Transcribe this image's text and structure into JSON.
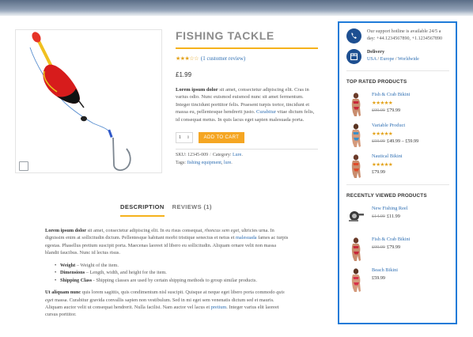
{
  "product": {
    "title": "FISHING TACKLE",
    "review_link": "(1 customer review)",
    "price": "£1.99",
    "desc_lead": "Lorem ipsum dolor",
    "desc_rest": " sit amet, consectetur adipiscing elit. Cras in varius odio. Nunc euismod euismod nunc sit amet fermentum. Integer tincidunt porttitor felis. Praesent turpis tortor, tincidunt et massa eu, pellentesque hendrerit justo. ",
    "desc_link": "Curabitur",
    "desc_tail": " vitae dictum felis, id consequat metus. In quis lacus eget sapien malesuada porta.",
    "quantity": "1",
    "add_to_cart": "ADD TO CART",
    "sku_label": "SKU:",
    "sku_value": "12345-009",
    "category_label": "Category:",
    "category_value": "Lure",
    "tags_label": "Tags:",
    "tag_1": "fishing equipment",
    "tag_2": "lure"
  },
  "tabs": {
    "description": "DESCRIPTION",
    "reviews": "REVIEWS (1)"
  },
  "description": {
    "p1_lead": "Lorem ipsum dolor",
    "p1_a": " sit amet, consectetur adipiscing elit. In eu risus consequat, ",
    "p1_italic": "rhoncus sem eget",
    "p1_b": ", ultricies urna. In dignissim enim at sollicitudin dictum. Pellentesque habitant morbi tristique senectus et netus et ",
    "p1_link": "malesuada",
    "p1_c": " fames ac turpis egestas. Phasellus pretium suscipit porta. Maecenas laoreet id libero eu sollicitudin. Aliquam ornare velit non massa blandit faucibus. Nunc id lectus risus.",
    "bullets": [
      {
        "label": "Weight",
        "text": " – Weight of the item."
      },
      {
        "label": "Dimensions",
        "text": " – Length, width, and height for the item."
      },
      {
        "label": "Shipping Class",
        "text": " - Shipping classes are used by certain shipping methods to group similar products."
      }
    ],
    "p2_lead": "Ut aliquam nunc",
    "p2_a": " quis lorem sagittis, quis condimentum nisl suscipit. Quisque at neque eget libero porta commodo ",
    "p2_italic": "quis eget",
    "p2_b": " massa. Curabitur gravida convallis sapien non vestibulum. Sed in mi eget sem venenatis dictum sed et mauris. Aliquam auctor velit ut consequat hendrerit. Nulla facilisi. Nam auctor vel lacus et ",
    "p2_link": "pretium",
    "p2_c": ". Integer varius elit laoreet cursus porttitor."
  },
  "sidebar": {
    "support_text": "Our support hotline is available 24/5 a day: +44.1234567890, +1.1234567890",
    "delivery_title": "Delivery",
    "delivery_usa": "USA",
    "delivery_europe": "Europe",
    "delivery_world": "Worldwide",
    "top_rated_heading": "TOP RATED PRODUCTS",
    "recently_viewed_heading": "RECENTLY VIEWED PRODUCTS",
    "top_rated": [
      {
        "name": "Fish & Crab Bikini",
        "old_price": "£99.99",
        "price": "£79.99"
      },
      {
        "name": "Variable Product",
        "old_price": "£59.99",
        "price": "£49.99 – £59.99"
      },
      {
        "name": "Nautical Bikini",
        "old_price": "",
        "price": "£79.99"
      }
    ],
    "recently_viewed": [
      {
        "name": "New Fishing Reel",
        "old_price": "£14.99",
        "price": "£11.99"
      },
      {
        "name": "Fish & Crab Bikini",
        "old_price": "£99.99",
        "price": "£79.99"
      },
      {
        "name": "Beach Bikini",
        "old_price": "",
        "price": "£59.99"
      }
    ]
  },
  "colors": {
    "accent": "#f5b21c",
    "button": "#f5a623",
    "link": "#2f6fb3",
    "sidebar_border": "#1f7bd8",
    "icon_bg": "#1d4f91"
  },
  "icons": {
    "support": "phone-icon",
    "delivery": "box-icon",
    "zoom": "expand-icon"
  }
}
